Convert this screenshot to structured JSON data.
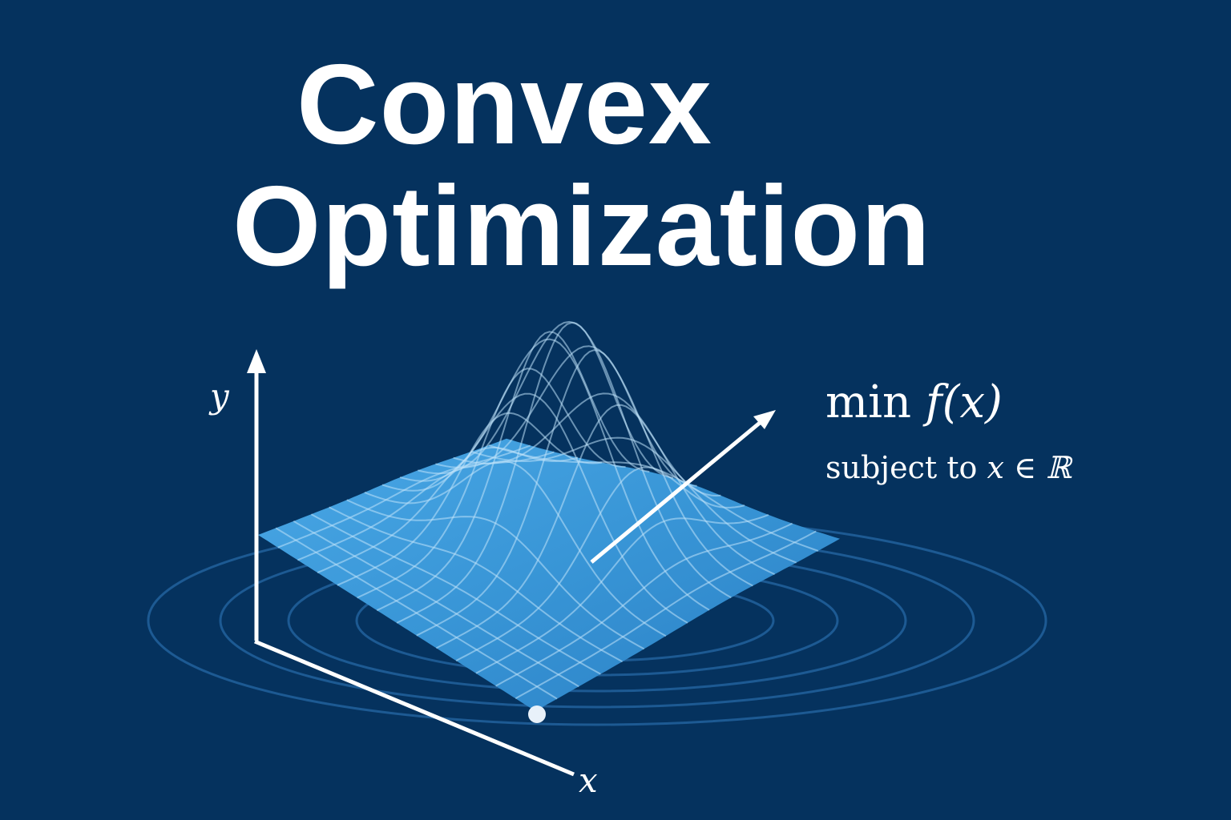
{
  "title": {
    "line1": "Convex",
    "line2": "Optimization"
  },
  "axes": {
    "y_label": "y",
    "x_label": "x"
  },
  "formula": {
    "objective_word": "min",
    "objective_function": "f(x)",
    "constraint_prefix": "subject to",
    "constraint_set": "x ∈ ℝ"
  },
  "colors": {
    "background": "#05325e",
    "surface": "#3b9ee0",
    "contour": "#1d5a93",
    "text": "#ffffff"
  }
}
